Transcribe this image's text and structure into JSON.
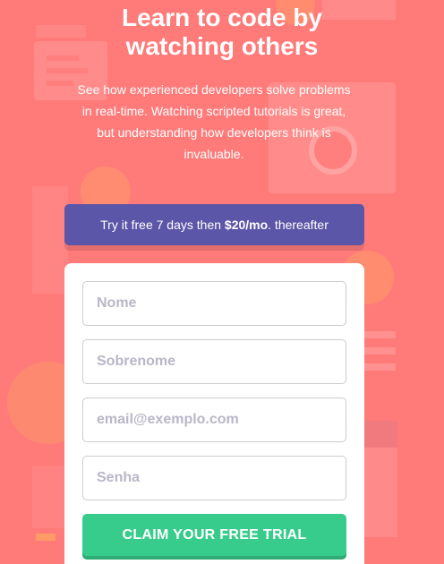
{
  "hero": {
    "title_line1": "Learn to code by",
    "title_line2": "watching others",
    "subtitle_line1": "See how experienced developers solve problems",
    "subtitle_line2": "in real-time. Watching scripted tutorials is great,",
    "subtitle_line3": "but understanding how developers think is",
    "subtitle_line4": "invaluable."
  },
  "trial": {
    "prefix": "Try it free 7 days then ",
    "price": "$20/mo",
    "suffix": ". thereafter"
  },
  "form": {
    "first_name_placeholder": "Nome",
    "last_name_placeholder": "Sobrenome",
    "email_placeholder": "email@exemplo.com",
    "password_placeholder": "Senha",
    "submit_label": "CLAIM YOUR FREE TRIAL"
  },
  "colors": {
    "background": "#fe7b7a",
    "banner": "#5c56a8",
    "accent_green": "#38cc8c"
  }
}
